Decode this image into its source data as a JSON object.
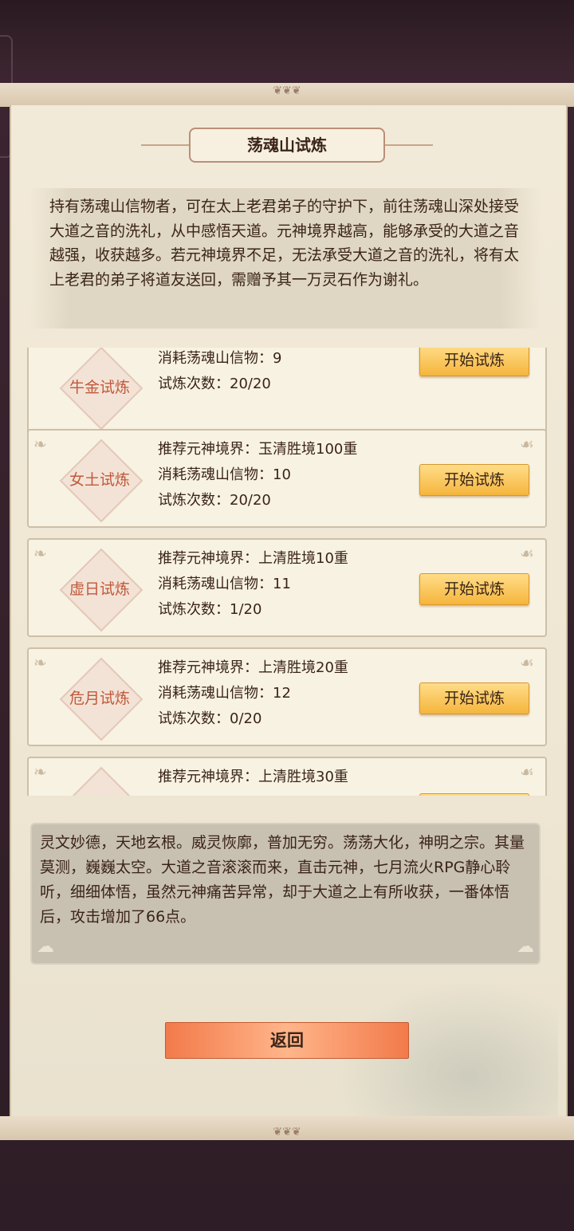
{
  "panel": {
    "title": "荡魂山试炼",
    "intro": "持有荡魂山信物者，可在太上老君弟子的守护下，前往荡魂山深处接受大道之音的洗礼，从中感悟天道。元神境界越高，能够承受的大道之音越强，收获越多。若元神境界不足，无法承受大道之音的洗礼，将有太上老君的弟子将道友送回，需赠予其一万灵石作为谢礼。"
  },
  "trials": [
    {
      "name": "牛金试炼",
      "realm": "",
      "cost": "消耗荡魂山信物：9",
      "count": "试炼次数：20/20",
      "button": "开始试炼"
    },
    {
      "name": "女土试炼",
      "realm": "推荐元神境界：玉清胜境100重",
      "cost": "消耗荡魂山信物：10",
      "count": "试炼次数：20/20",
      "button": "开始试炼"
    },
    {
      "name": "虚日试炼",
      "realm": "推荐元神境界：上清胜境10重",
      "cost": "消耗荡魂山信物：11",
      "count": "试炼次数：1/20",
      "button": "开始试炼"
    },
    {
      "name": "危月试炼",
      "realm": "推荐元神境界：上清胜境20重",
      "cost": "消耗荡魂山信物：12",
      "count": "试炼次数：0/20",
      "button": "开始试炼"
    },
    {
      "name": "",
      "realm": "推荐元神境界：上清胜境30重",
      "cost": "",
      "count": "",
      "button": ""
    }
  ],
  "log": {
    "text": "灵文妙德，天地玄根。威灵恢廓，普加无穷。荡荡大化，神明之宗。其量莫测，巍巍太空。大道之音滚滚而来，直击元神，七月流火RPG静心聆听，细细体悟，虽然元神痛苦异常，却于大道之上有所收获，一番体悟后，攻击增加了66点。"
  },
  "footer": {
    "back_label": "返回"
  }
}
